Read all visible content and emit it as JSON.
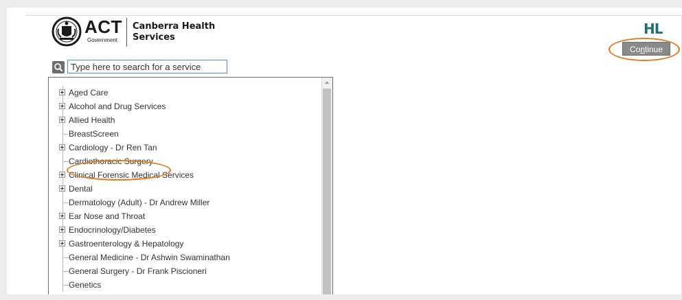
{
  "header": {
    "logo_act": "ACT",
    "logo_government": "Government",
    "logo_org_line1": "Canberra Health",
    "logo_org_line2": "Services",
    "hl_logo": "HL",
    "continue_pre": "Co",
    "continue_accel": "n",
    "continue_post": "tinue"
  },
  "search": {
    "placeholder": "Type here to search for a service",
    "icon": "search-icon"
  },
  "tree": {
    "items": [
      {
        "label": "Aged Care",
        "expandable": true
      },
      {
        "label": "Alcohol and Drug Services",
        "expandable": true
      },
      {
        "label": "Allied Health",
        "expandable": true
      },
      {
        "label": "BreastScreen",
        "expandable": false
      },
      {
        "label": "Cardiology - Dr Ren Tan",
        "expandable": true
      },
      {
        "label": "Cardiothoracic Surgery",
        "expandable": false
      },
      {
        "label": "Clinical Forensic Medical Services",
        "expandable": true
      },
      {
        "label": "Dental",
        "expandable": true
      },
      {
        "label": "Dermatology (Adult) - Dr Andrew Miller",
        "expandable": false
      },
      {
        "label": "Ear Nose and Throat",
        "expandable": true
      },
      {
        "label": "Endocrinology/Diabetes",
        "expandable": true
      },
      {
        "label": "Gastroenterology & Hepatology",
        "expandable": true
      },
      {
        "label": "General Medicine - Dr Ashwin Swaminathan",
        "expandable": false
      },
      {
        "label": "General Surgery - Dr Frank Piscioneri",
        "expandable": false
      },
      {
        "label": "Genetics",
        "expandable": false
      }
    ]
  },
  "colors": {
    "accent_highlight": "#e07b24",
    "hl_brand": "#1e6e78",
    "button_bg": "#8a8a8a"
  }
}
